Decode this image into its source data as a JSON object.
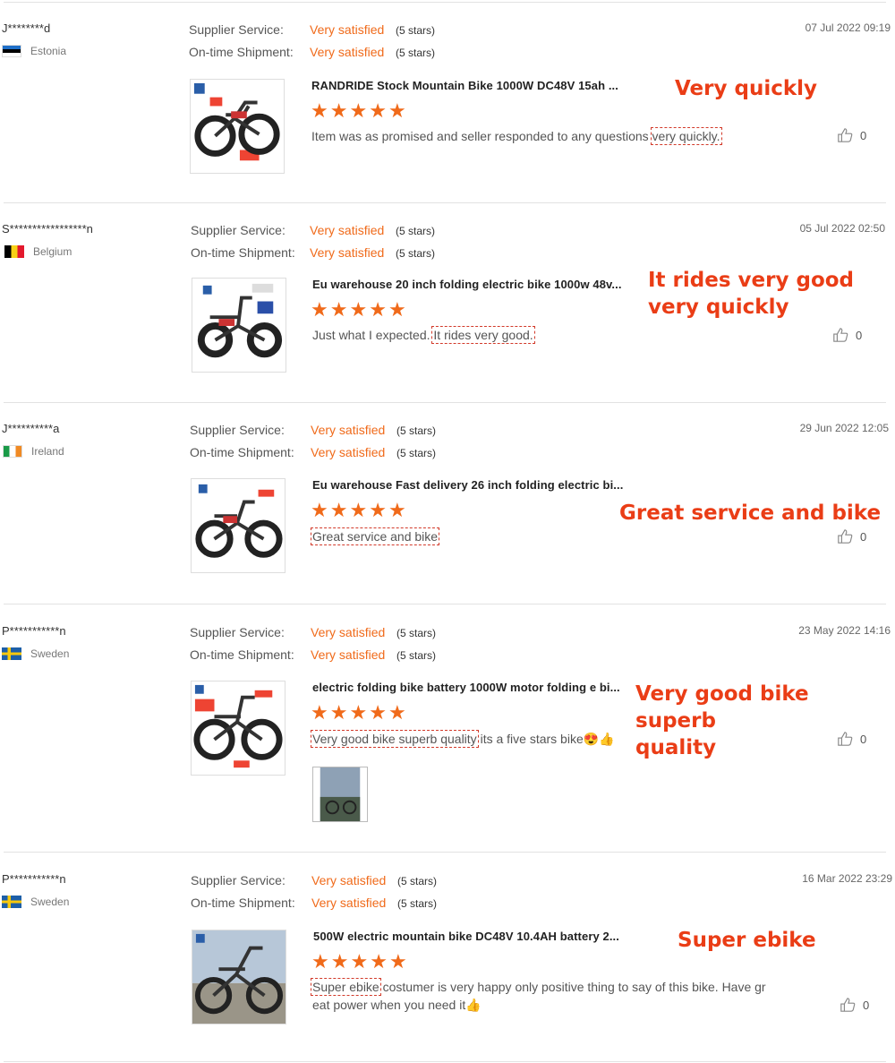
{
  "labels": {
    "supplier_service": "Supplier Service:",
    "on_time_shipment": "On-time Shipment:",
    "rating_value": "Very satisfied",
    "rating_stars": "(5 stars)"
  },
  "reviews": [
    {
      "user": "J********d",
      "country": "Estonia",
      "flag": "estonia-flag",
      "date": "07 Jul 2022 09:19",
      "product_title": "RANDRIDE Stock Mountain Bike 1000W DC48V 15ah ...",
      "feedback_before": "Item was as promised and seller responded to any questions ",
      "feedback_highlight": "very quickly.",
      "feedback_after": "",
      "likes": "0",
      "annotation": [
        "Very quickly"
      ]
    },
    {
      "user": "S*****************n",
      "country": "Belgium",
      "flag": "belgium-flag",
      "date": "05 Jul 2022 02:50",
      "product_title": "Eu warehouse 20 inch folding electric bike 1000w 48v...",
      "feedback_before": "Just what I expected. ",
      "feedback_highlight": "It rides very good.",
      "feedback_after": "",
      "likes": "0",
      "annotation": [
        "It rides very good",
        "very quickly"
      ]
    },
    {
      "user": "J**********a",
      "country": "Ireland",
      "flag": "ireland-flag",
      "date": "29 Jun 2022 12:05",
      "product_title": "Eu warehouse Fast delivery 26 inch folding electric bi...",
      "feedback_before": "",
      "feedback_highlight": "Great service and bike",
      "feedback_after": "",
      "likes": "0",
      "annotation": [
        "Great service and bike"
      ]
    },
    {
      "user": "P***********n",
      "country": "Sweden",
      "flag": "sweden-flag",
      "date": "23 May 2022 14:16",
      "product_title": "electric folding bike battery 1000W motor folding e bi...",
      "feedback_before": "",
      "feedback_highlight": "Very good bike superb quality",
      "feedback_after": " its a five stars bike",
      "feedback_emojis": [
        "😍",
        "👍"
      ],
      "likes": "0",
      "annotation": [
        "Very good bike superb",
        "quality"
      ]
    },
    {
      "user": "P***********n",
      "country": "Sweden",
      "flag": "sweden-flag",
      "date": "16 Mar 2022 23:29",
      "product_title": "500W electric mountain bike DC48V 10.4AH battery 2...",
      "feedback_before": "",
      "feedback_highlight": "Super ebike",
      "feedback_after": " costumer is very happy only positive thing to say of this bike. Have gr",
      "feedback_line2": "eat power when you need it",
      "feedback_emojis": [
        "👍"
      ],
      "likes": "0",
      "annotation": [
        "Super ebike"
      ]
    }
  ],
  "colors": {
    "accent": "#f06a1a",
    "annotation": "#ea3d16",
    "highlight_border": "#d23a2a"
  }
}
